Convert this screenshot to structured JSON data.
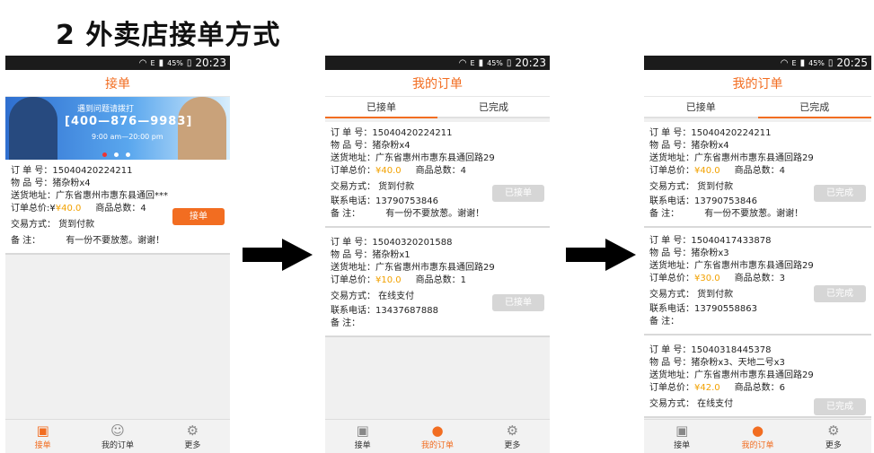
{
  "slide_title": "2 外卖店接单方式",
  "status_bar": {
    "battery": "45%",
    "signal": "E",
    "times": [
      "20:23",
      "20:23",
      "20:25"
    ]
  },
  "screen1": {
    "app_title": "接单",
    "banner": {
      "hint": "遇到问题请拨打",
      "phone": "[400—876—9983]",
      "hours": "9:00 am—20:00 pm"
    },
    "order": {
      "order_no": "订 单 号：15040420224211",
      "items": "物 品 号：猪杂粉x4",
      "address": "送货地址：广东省惠州市惠东县通回***",
      "total_label": "订单总价:¥",
      "total_price": "¥40.0",
      "qty": "商品总数：4",
      "payment": "交易方式：   货到付款",
      "note_label": "备  注：",
      "note": "有一份不要放葱。谢谢！",
      "button": "接单"
    }
  },
  "screen2": {
    "app_title": "我的订单",
    "tabs": [
      "已接单",
      "已完成"
    ],
    "orders": [
      {
        "order_no": "订 单 号：15040420224211",
        "items": "物 品 号：猪杂粉x4",
        "address": "送货地址：广东省惠州市惠东县通回路29",
        "total_label": "订单总价：",
        "total_price": "¥40.0",
        "qty": "商品总数：4",
        "payment": "交易方式：   货到付款",
        "phone": "联系电话：13790753846",
        "note_label": "备    注：",
        "note": "有一份不要放葱。谢谢！",
        "button": "已接单"
      },
      {
        "order_no": "订 单 号：15040320201588",
        "items": "物 品 号：猪杂粉x1",
        "address": "送货地址：广东省惠州市惠东县通回路29",
        "total_label": "订单总价：",
        "total_price": "¥10.0",
        "qty": "商品总数：1",
        "payment": "交易方式：   在线支付",
        "phone": "联系电话：13437687888",
        "note_label": "备    注：",
        "note": "",
        "button": "已接单"
      }
    ]
  },
  "screen3": {
    "app_title": "我的订单",
    "tabs": [
      "已接单",
      "已完成"
    ],
    "orders": [
      {
        "order_no": "订 单 号：15040420224211",
        "items": "物 品 号：猪杂粉x4",
        "address": "送货地址：广东省惠州市惠东县通回路29",
        "total_label": "订单总价：",
        "total_price": "¥40.0",
        "qty": "商品总数：4",
        "payment": "交易方式：   货到付款",
        "phone": "联系电话：13790753846",
        "note_label": "备    注：",
        "note": "有一份不要放葱。谢谢！",
        "button": "已完成"
      },
      {
        "order_no": "订 单 号：15040417433878",
        "items": "物 品 号：猪杂粉x3",
        "address": "送货地址：广东省惠州市惠东县通回路29",
        "total_label": "订单总价：",
        "total_price": "¥30.0",
        "qty": "商品总数：3",
        "payment": "交易方式：   货到付款",
        "phone": "联系电话：13790558863",
        "note_label": "备    注：",
        "note": "",
        "button": "已完成"
      },
      {
        "order_no": "订 单 号：15040318445378",
        "items": "物 品 号：猪杂粉x3、天地二号x3",
        "address": "送货地址：广东省惠州市惠东县通回路29",
        "total_label": "订单总价：",
        "total_price": "¥42.0",
        "qty": "商品总数：6",
        "payment": "交易方式：   在线支付",
        "button": "已完成"
      }
    ]
  },
  "bottom_nav": {
    "items": [
      "接单",
      "我的订单",
      "更多"
    ]
  },
  "colors": {
    "accent": "#f26d21",
    "price": "#f2a100",
    "disabled_button": "#d6d6d6"
  }
}
